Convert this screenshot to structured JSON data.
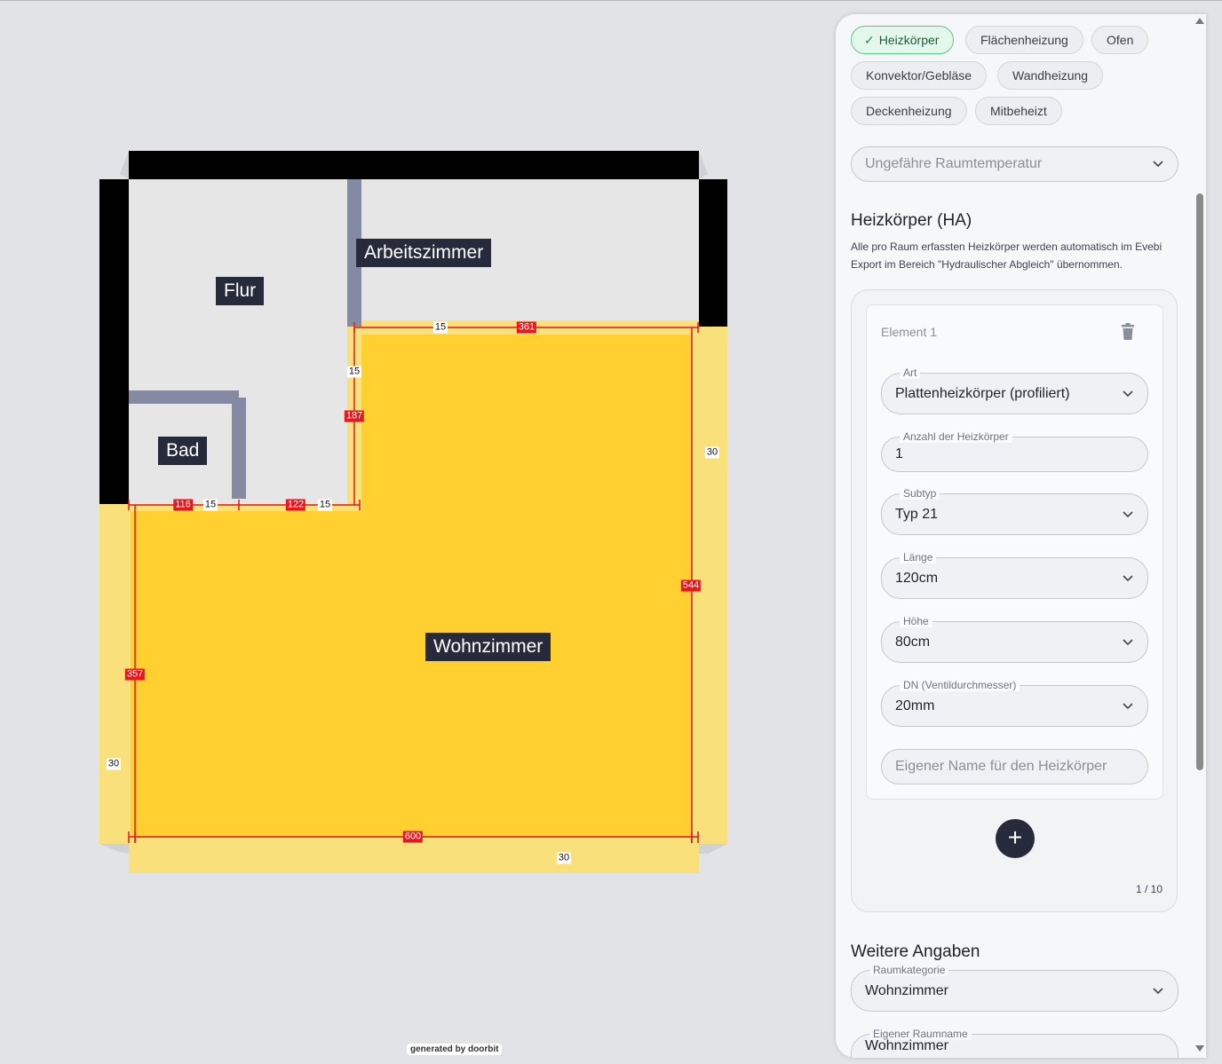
{
  "plan": {
    "rooms": [
      "Flur",
      "Arbeitszimmer",
      "Bad",
      "Wohnzimmer"
    ],
    "dimensions_red": [
      "361",
      "187",
      "116",
      "122",
      "544",
      "357",
      "600"
    ],
    "dimensions_white": [
      "15",
      "15",
      "15",
      "15",
      "30",
      "30",
      "30"
    ],
    "footer": "generated by doorbit",
    "colors": {
      "wall": "#000000",
      "inner_wall": "#858aa3",
      "floor": "#e6e6e6",
      "selected_room": "#ffd030",
      "selected_outline": "#fae07a",
      "dimension": "#e8161e"
    }
  },
  "panel": {
    "chips": [
      {
        "label": "Heizkörper",
        "active": true
      },
      {
        "label": "Flächenheizung",
        "active": false
      },
      {
        "label": "Ofen",
        "active": false
      },
      {
        "label": "Konvektor/Gebläse",
        "active": false
      },
      {
        "label": "Wandheizung",
        "active": false
      },
      {
        "label": "Deckenheizung",
        "active": false
      },
      {
        "label": "Mitbeheizt",
        "active": false
      }
    ],
    "room_temp_placeholder": "Ungefähre Raumtemperatur",
    "ha_title": "Heizkörper (HA)",
    "ha_desc": "Alle pro Raum erfassten Heizkörper werden automatisch im Evebi Export im Bereich \"Hydraulischer Abgleich\" übernommen.",
    "element": {
      "title": "Element 1",
      "art_label": "Art",
      "art_value": "Plattenheizkörper (profiliert)",
      "anzahl_label": "Anzahl der Heizkörper",
      "anzahl_value": "1",
      "subtyp_label": "Subtyp",
      "subtyp_value": "Typ 21",
      "laenge_label": "Länge",
      "laenge_value": "120cm",
      "hoehe_label": "Höhe",
      "hoehe_value": "80cm",
      "dn_label": "DN (Ventildurchmesser)",
      "dn_value": "20mm",
      "name_placeholder": "Eigener Name für den Heizkörper"
    },
    "add_button": "+",
    "pager": "1 / 10",
    "weitere_title": "Weitere Angaben",
    "raumkategorie_label": "Raumkategorie",
    "raumkategorie_value": "Wohnzimmer",
    "raumname_label": "Eigener Raumname",
    "raumname_value": "Wohnzimmer"
  }
}
